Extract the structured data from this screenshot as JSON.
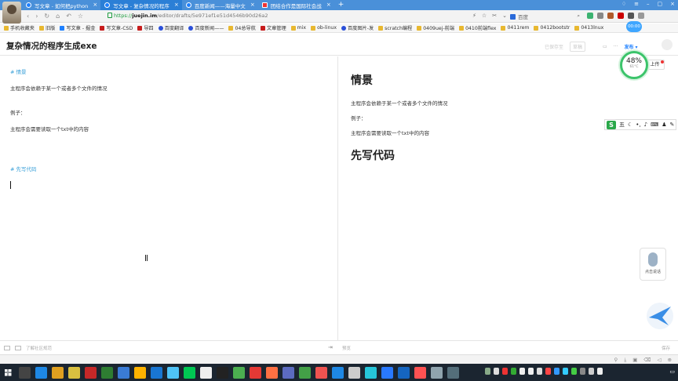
{
  "browser": {
    "tabs": [
      {
        "label": "写文章 - 如何把python",
        "active": false
      },
      {
        "label": "写文章 - 复杂情况的程序",
        "active": true
      },
      {
        "label": "百度新闻——海量中文",
        "active": false
      },
      {
        "label": "团结合作是国际社会战",
        "active": false
      }
    ],
    "url_scheme": "https://",
    "url_domain": "juejin.im",
    "url_path": "/editor/drafts/5e971ef1e51d4546b90d26a2",
    "search_placeholder": "百度",
    "network_badge": "00:00"
  },
  "bookmarks": [
    "手机收藏夹",
    "旧版",
    "写文章 - 掘金",
    "写文章-CSD",
    "导四",
    "百度翻译",
    "百度新闻——",
    "04总导航",
    "文章管理",
    "mix",
    "ob-linux",
    "百度图片-发",
    "scratch编程",
    "0409uej-前端",
    "0410前端flex",
    "0411rem",
    "0412bootstr",
    "0413lnux"
  ],
  "editor": {
    "title": "复杂情况的程序生成exe",
    "save_status": "已保存至",
    "draft_label": "草稿",
    "publish_label": "发布",
    "markdown_lines": [
      {
        "text": "# 情景",
        "heading": true
      },
      {
        "text": "主程序会依赖于某一个或者多个文件的情况",
        "heading": false
      },
      {
        "text": "例子：",
        "heading": false
      },
      {
        "text": "主程序会需要读取一个txt中的内容",
        "heading": false
      },
      {
        "text": "# 先写代码",
        "heading": true
      }
    ],
    "preview": {
      "h1_a": "情景",
      "p1": "主程序会依赖于某一个或者多个文件的情况",
      "p2": "例子：",
      "p3": "主程序会需要读取一个txt中的内容",
      "h1_b": "先写代码"
    },
    "footer_left": "了解社区规范",
    "footer_right": "预览",
    "footer_far": "保存"
  },
  "widgets": {
    "cpu_percent": "48%",
    "cpu_temp": "61°C",
    "upload_label": "上传",
    "ime_label": "五",
    "mic_label": "点击说话"
  }
}
